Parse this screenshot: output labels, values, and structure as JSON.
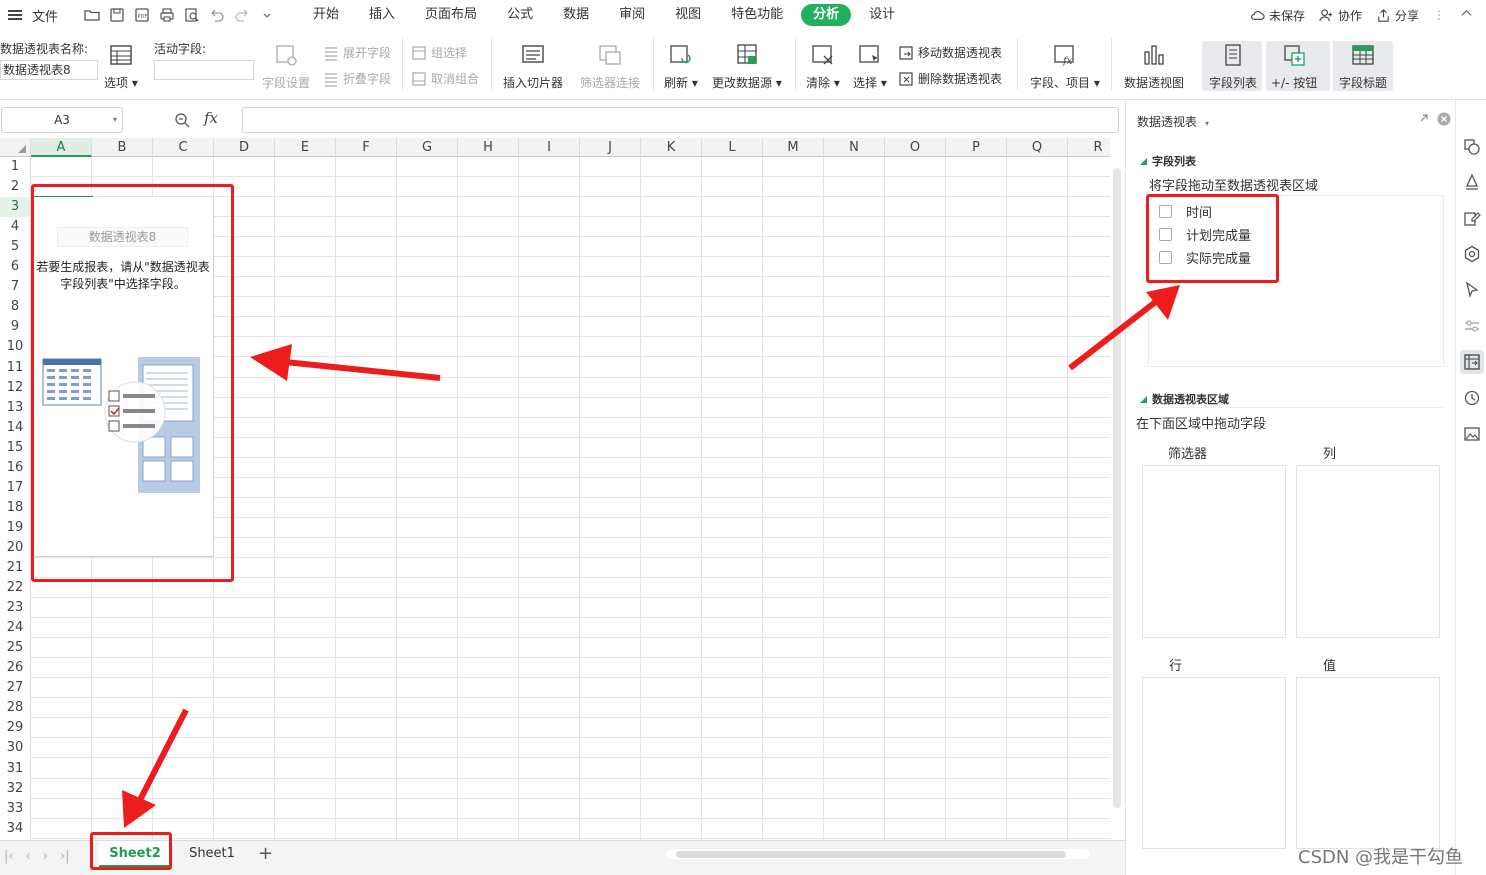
{
  "menubar": {
    "file_label": "文件",
    "tabs": [
      "开始",
      "插入",
      "页面布局",
      "公式",
      "数据",
      "审阅",
      "视图",
      "特色功能",
      "分析",
      "设计"
    ],
    "active_tab": "分析",
    "right": {
      "unsaved": "未保存",
      "collab": "协作",
      "share": "分享"
    }
  },
  "ribbon": {
    "pivot_name_label": "数据透视表名称:",
    "pivot_name_value": "数据透视表8",
    "options": "选项",
    "active_field_label": "活动字段:",
    "active_field_value": "",
    "field_settings": "字段设置",
    "expand_field": "展开字段",
    "collapse_field": "折叠字段",
    "group_selection": "组选择",
    "ungroup": "取消组合",
    "insert_slicer": "插入切片器",
    "filter_connection": "筛选器连接",
    "refresh": "刷新",
    "change_source": "更改数据源",
    "clear": "清除",
    "select": "选择",
    "move_pivot": "移动数据透视表",
    "delete_pivot": "删除数据透视表",
    "fields_items": "字段、项目",
    "pivot_chart": "数据透视图",
    "field_list": "字段列表",
    "plus_minus": "+/- 按钮",
    "field_headers": "字段标题"
  },
  "formula_bar": {
    "name_box": "A3",
    "fx": "fx",
    "formula": ""
  },
  "grid": {
    "columns": [
      "A",
      "B",
      "C",
      "D",
      "E",
      "F",
      "G",
      "H",
      "I",
      "J",
      "K",
      "L",
      "M",
      "N",
      "O",
      "P",
      "Q",
      "R"
    ],
    "rows": [
      "1",
      "2",
      "3",
      "4",
      "5",
      "6",
      "7",
      "8",
      "9",
      "10",
      "11",
      "12",
      "13",
      "14",
      "15",
      "16",
      "17",
      "18",
      "19",
      "20",
      "21",
      "22",
      "23",
      "24",
      "25",
      "26",
      "27",
      "28",
      "29",
      "30",
      "31",
      "32",
      "33",
      "34"
    ],
    "selected_col": "A",
    "selected_row": "3",
    "pivot_placeholder": {
      "title": "数据透视表8",
      "message_line1": "若要生成报表，请从\"数据透视表",
      "message_line2": "字段列表\"中选择字段。"
    }
  },
  "sheets": {
    "tabs": [
      "Sheet2",
      "Sheet1"
    ],
    "active": "Sheet2",
    "add": "+"
  },
  "panel": {
    "title": "数据透视表",
    "field_list_section": "字段列表",
    "field_list_note": "将字段拖动至数据透视表区域",
    "fields": [
      "时间",
      "计划完成量",
      "实际完成量"
    ],
    "areas_section": "数据透视表区域",
    "areas_note": "在下面区域中拖动字段",
    "areas": {
      "filter": "筛选器",
      "columns": "列",
      "rows": "行",
      "values": "值"
    }
  },
  "colors": {
    "accent": "#22b05c",
    "annotation": "#ee1d1d",
    "selection": "#1d9b4e"
  },
  "watermark": "CSDN @我是干勾鱼"
}
